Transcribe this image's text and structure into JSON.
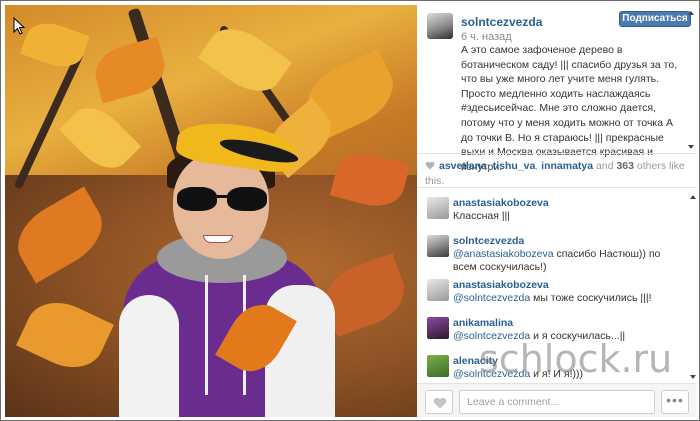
{
  "post": {
    "author": "solntcezvezda",
    "time_ago": "6 ч. назад",
    "follow_label": "Подписаться",
    "caption": "А это самое зафоченое дерево в ботаническом саду! ||| спасибо друзья за то, что вы уже много лет учите меня гулять. Просто медленно ходить наслаждаясь #здесьисейчас. Мне это сложно дается, потому что у меня ходить можно от точка А до точки В. Но я стараюсь! ||| прекрасные выхи и Москва оказывается красивая и изнутри."
  },
  "likes": {
    "users": [
      "asvetlana",
      "tishu_va",
      "innamatya"
    ],
    "sep1": ", ",
    "sep2": ", ",
    "and_text": " and ",
    "count": "363",
    "suffix": " others like this."
  },
  "comments": [
    {
      "user": "anastasiakobozeva",
      "mention": "",
      "text": "Классная |||"
    },
    {
      "user": "solntcezvezda",
      "mention": "@anastasiakobozeva",
      "text": " спасибо Настюш)) по всем соскучилась!)"
    },
    {
      "user": "anastasiakobozeva",
      "mention": "@solntcezvezda",
      "text": " мы тоже соскучились |||!"
    },
    {
      "user": "anikamalina",
      "mention": "@solntcezvezda",
      "text": " и я соскучилась...||"
    },
    {
      "user": "alenacity",
      "mention": "@solntcezvezda",
      "text": " и я! И я!)))"
    }
  ],
  "footer": {
    "comment_placeholder": "Leave a comment...",
    "more_label": "•••"
  },
  "watermark": "schlock.ru",
  "colors": {
    "link": "#2a5f93",
    "follow_button": "#4a7aaf"
  }
}
